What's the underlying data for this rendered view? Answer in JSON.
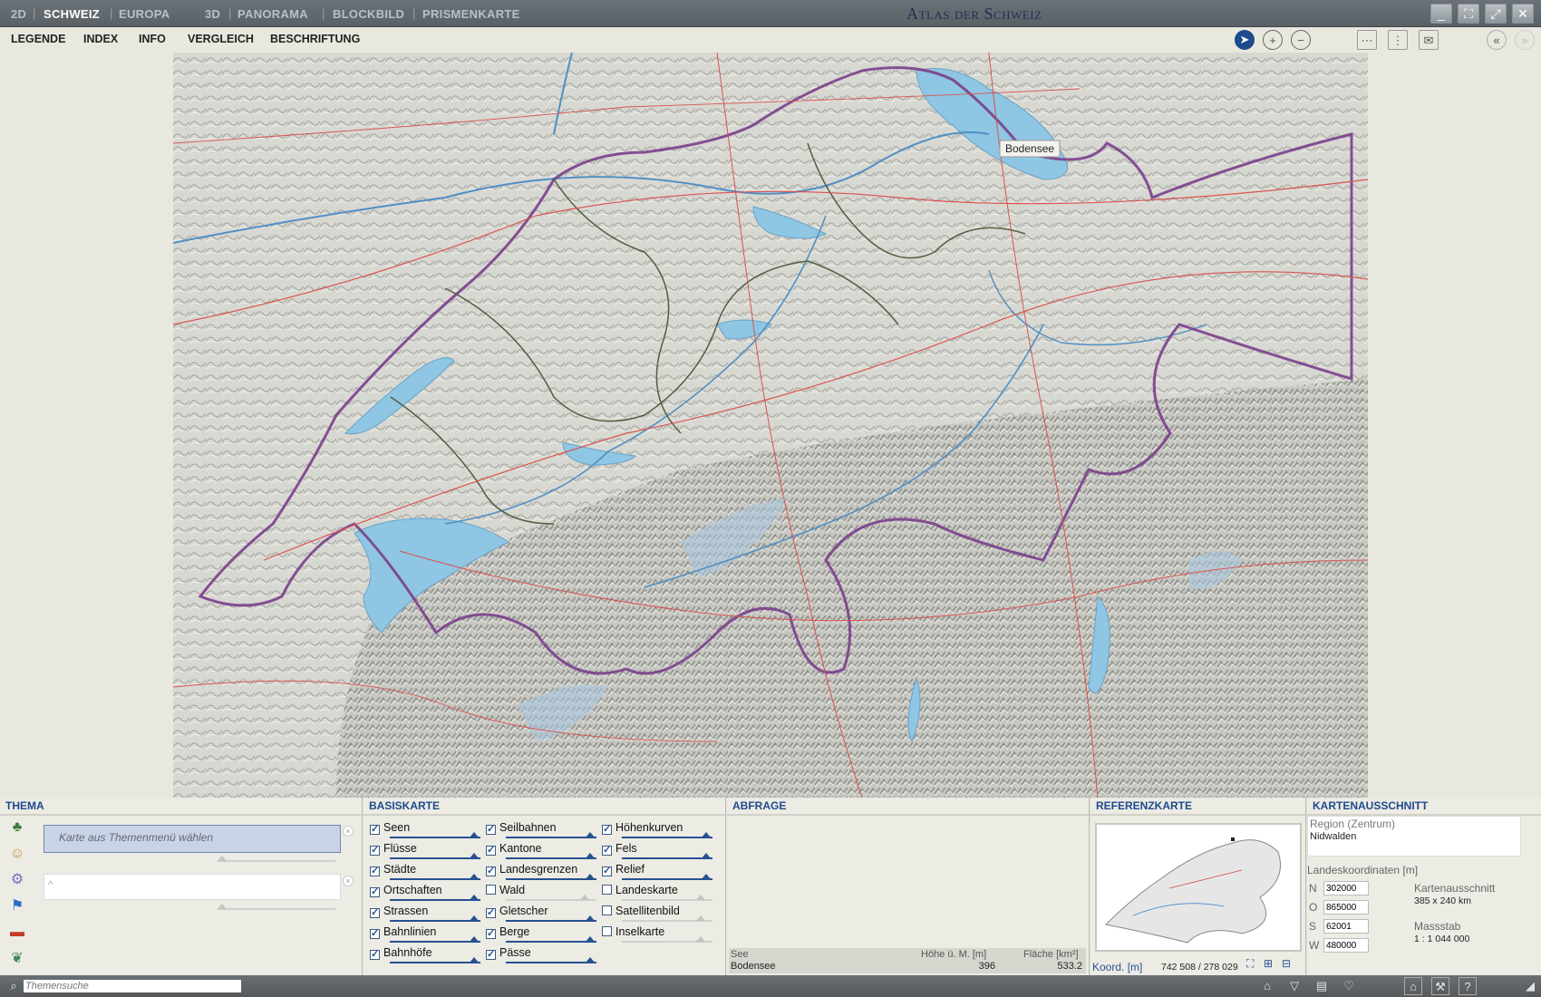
{
  "titlebar": {
    "modes_2d": [
      "2D",
      "SCHWEIZ",
      "EUROPA"
    ],
    "modes_3d": [
      "3D",
      "PANORAMA",
      "BLOCKBILD",
      "PRISMENKARTE"
    ],
    "app_title": "Atlas der Schweiz"
  },
  "menu": {
    "items": [
      "LEGENDE",
      "INDEX",
      "INFO",
      "VERGLEICH",
      "BESCHRIFTUNG"
    ]
  },
  "map": {
    "label": "Bodensee"
  },
  "thema": {
    "title": "THEMA",
    "placeholder": "Karte aus Themenmenü wählen"
  },
  "basiskarte": {
    "title": "BASISKARTE",
    "col1": [
      {
        "label": "Seen",
        "checked": true
      },
      {
        "label": "Flüsse",
        "checked": true
      },
      {
        "label": "Städte",
        "checked": true
      },
      {
        "label": "Ortschaften",
        "checked": true
      },
      {
        "label": "Strassen",
        "checked": true
      },
      {
        "label": "Bahnlinien",
        "checked": true
      },
      {
        "label": "Bahnhöfe",
        "checked": true
      }
    ],
    "col2": [
      {
        "label": "Seilbahnen",
        "checked": true
      },
      {
        "label": "Kantone",
        "checked": true
      },
      {
        "label": "Landesgrenzen",
        "checked": true
      },
      {
        "label": "Wald",
        "checked": false
      },
      {
        "label": "Gletscher",
        "checked": true
      },
      {
        "label": "Berge",
        "checked": true
      },
      {
        "label": "Pässe",
        "checked": true
      }
    ],
    "col3": [
      {
        "label": "Höhenkurven",
        "checked": true
      },
      {
        "label": "Fels",
        "checked": true
      },
      {
        "label": "Relief",
        "checked": true
      },
      {
        "label": "Landeskarte",
        "checked": false
      },
      {
        "label": "Satellitenbild",
        "checked": false
      },
      {
        "label": "Inselkarte",
        "checked": false
      }
    ]
  },
  "abfrage": {
    "title": "ABFRAGE",
    "col_type": "See",
    "col_height": "Höhe ü. M. [m]",
    "col_area": "Fläche [km²]",
    "name": "Bodensee",
    "height": "396",
    "area": "533.2"
  },
  "referenz": {
    "title": "REFERENZKARTE",
    "coord_label": "Koord. [m]",
    "coord_value": "742 508 / 278 029"
  },
  "ausschnitt": {
    "title": "KARTENAUSSCHNITT",
    "region_label": "Region (Zentrum)",
    "region_value": "Nidwalden",
    "coords_label": "Landeskoordinaten [m]",
    "n_label": "N",
    "n_value": "302000",
    "o_label": "O",
    "o_value": "865000",
    "s_label": "S",
    "s_value": "62001",
    "w_label": "W",
    "w_value": "480000",
    "size_label": "Kartenausschnitt",
    "size_value": "385 x 240 km",
    "scale_label": "Massstab",
    "scale_value": "1 : 1 044 000"
  },
  "status": {
    "search_placeholder": "Themensuche"
  }
}
